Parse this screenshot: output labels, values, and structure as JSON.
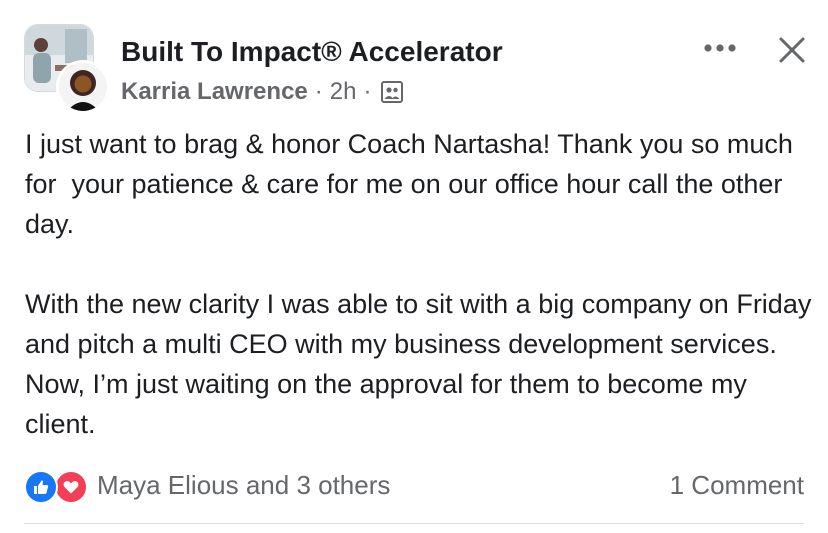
{
  "post": {
    "group_name": "Built To Impact® Accelerator",
    "author": "Karria Lawrence",
    "separator_1": "·",
    "time": "2h",
    "separator_2": "·",
    "audience_icon": "group-members-icon",
    "body_paragraphs": [
      "I just want to brag & honor Coach Nartasha! Thank you so much for  your patience & care for me on our office hour call the other day.",
      "With the new clarity I was able to sit with a big company on Friday and pitch a multi CEO with my business development services. Now, I’m just waiting on the approval for them to become my client."
    ]
  },
  "actions": {
    "more_icon": "more-options-icon",
    "close_icon": "close-icon"
  },
  "reactions": {
    "icons": [
      "like-reaction-icon",
      "love-reaction-icon"
    ],
    "summary": "Maya Elious and 3 others",
    "comments": "1 Comment"
  },
  "colors": {
    "text_primary": "#1c1e21",
    "text_secondary": "#65676b",
    "like_blue": "#1877f2",
    "love_red": "#f33e58",
    "divider": "#dadde1"
  }
}
